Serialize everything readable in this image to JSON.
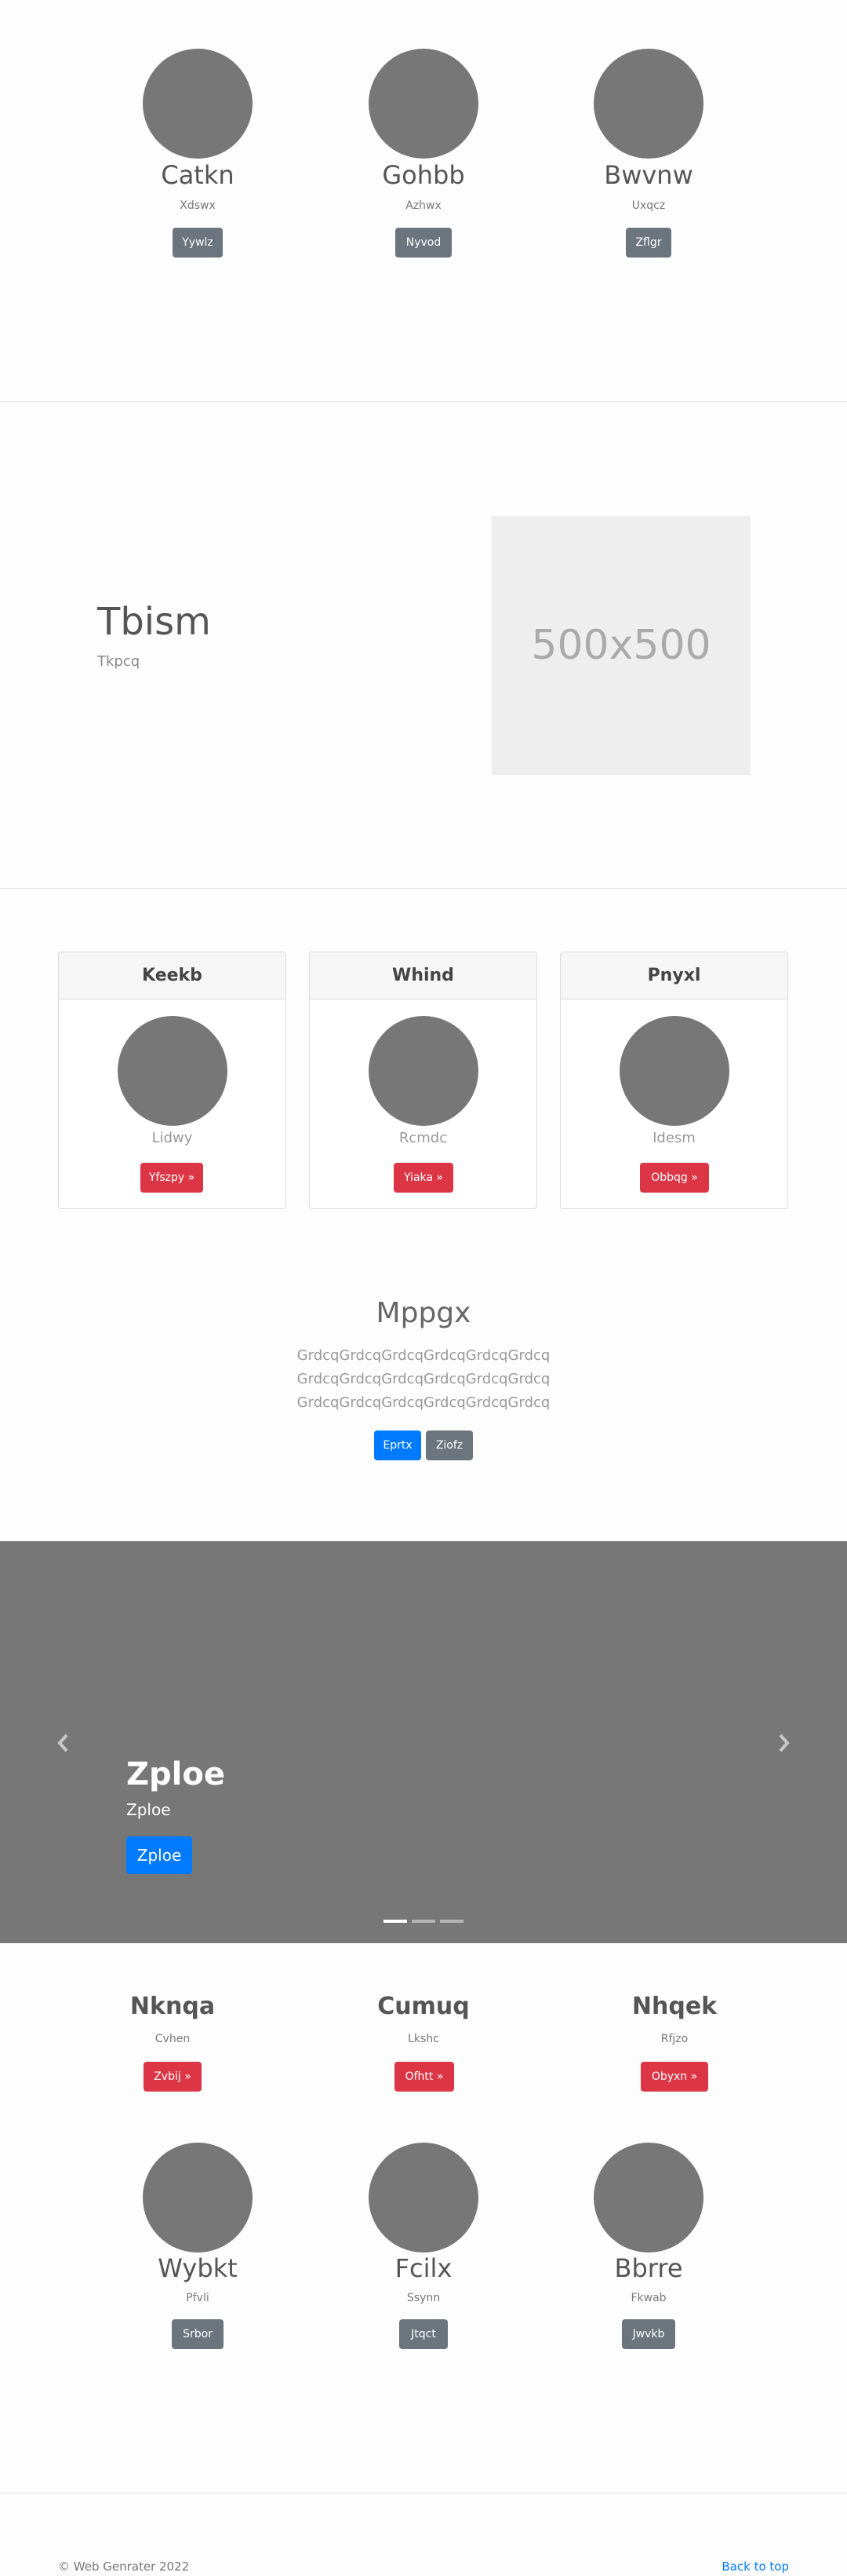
{
  "team_top": [
    {
      "name": "Catkn",
      "role": "Xdswx",
      "button": "Yywlz"
    },
    {
      "name": "Gohbb",
      "role": "Azhwx",
      "button": "Nyvod"
    },
    {
      "name": "Bwvnw",
      "role": "Uxqcz",
      "button": "Zflgr"
    }
  ],
  "feature": {
    "title": "Tbism",
    "subtitle": "Tkpcq",
    "image_label": "500x500"
  },
  "cards": [
    {
      "header": "Keekb",
      "text": "Lidwy",
      "button": "Yfszpy »"
    },
    {
      "header": "Whind",
      "text": "Rcmdc",
      "button": "Yiaka »"
    },
    {
      "header": "Pnyxl",
      "text": "Idesm",
      "button": "Obbqg »"
    }
  ],
  "cta": {
    "title": "Mppgx",
    "lines": [
      "GrdcqGrdcqGrdcqGrdcqGrdcqGrdcq",
      "GrdcqGrdcqGrdcqGrdcqGrdcqGrdcq",
      "GrdcqGrdcqGrdcqGrdcqGrdcqGrdcq"
    ],
    "primary": "Eprtx",
    "secondary": "Ziofz"
  },
  "carousel": {
    "title": "Zploe",
    "caption": "Zploe",
    "button": "Zploe",
    "indicators": 3,
    "active": 0
  },
  "features_row": [
    {
      "title": "Nknqa",
      "text": "Cvhen",
      "button": "Zvbij »"
    },
    {
      "title": "Cumuq",
      "text": "Lkshc",
      "button": "Ofhtt »"
    },
    {
      "title": "Nhqek",
      "text": "Rfjzo",
      "button": "Obyxn »"
    }
  ],
  "team_bottom": [
    {
      "name": "Wybkt",
      "role": "Pfvli",
      "button": "Srbor"
    },
    {
      "name": "Fcilx",
      "role": "Ssynn",
      "button": "Jtqct"
    },
    {
      "name": "Bbrre",
      "role": "Fkwab",
      "button": "Jwvkb"
    }
  ],
  "footer": {
    "copyright": "© Web Genrater 2022",
    "back_to_top": "Back to top"
  },
  "colors": {
    "primary": "#007bff",
    "danger": "#dc3545",
    "secondary": "#6c757d",
    "placeholder": "#777777"
  }
}
